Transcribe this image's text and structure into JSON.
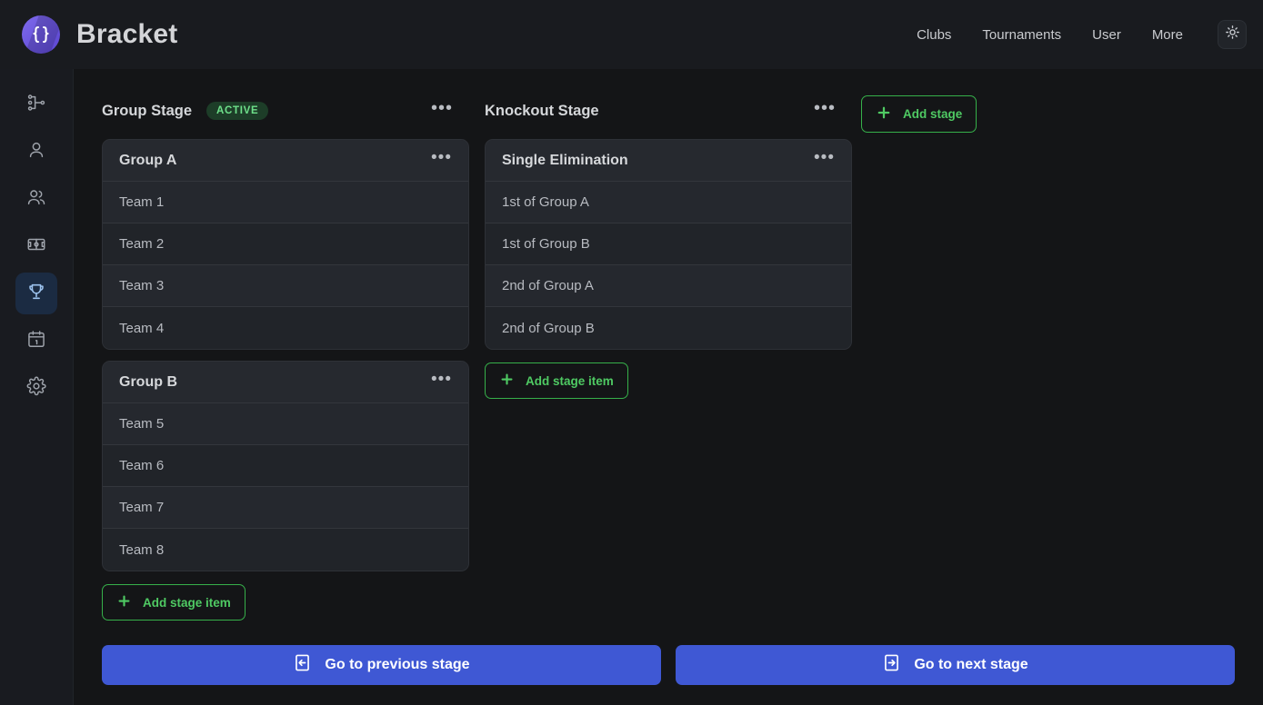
{
  "header": {
    "brand_name": "Bracket",
    "logo_icon": "curly-braces-logo",
    "nav": [
      {
        "label": "Clubs"
      },
      {
        "label": "Tournaments"
      },
      {
        "label": "User"
      },
      {
        "label": "More"
      }
    ],
    "theme_toggle_icon": "sun-icon"
  },
  "sidebar": {
    "items": [
      {
        "icon": "bracket-icon",
        "name": "sidebar-item-brackets",
        "active": false
      },
      {
        "icon": "user-icon",
        "name": "sidebar-item-user",
        "active": false
      },
      {
        "icon": "users-icon",
        "name": "sidebar-item-teams",
        "active": false
      },
      {
        "icon": "field-icon",
        "name": "sidebar-item-courts",
        "active": false
      },
      {
        "icon": "trophy-icon",
        "name": "sidebar-item-tournaments",
        "active": true
      },
      {
        "icon": "calendar-icon",
        "name": "sidebar-item-schedule",
        "active": false
      },
      {
        "icon": "gear-icon",
        "name": "sidebar-item-settings",
        "active": false
      }
    ]
  },
  "stages": {
    "group_stage": {
      "title": "Group Stage",
      "badge": "ACTIVE",
      "menu_icon": "ellipsis-icon",
      "cards": [
        {
          "title": "Group A",
          "menu_icon": "ellipsis-icon",
          "rows": [
            "Team 1",
            "Team 2",
            "Team 3",
            "Team 4"
          ]
        },
        {
          "title": "Group B",
          "menu_icon": "ellipsis-icon",
          "rows": [
            "Team 5",
            "Team 6",
            "Team 7",
            "Team 8"
          ]
        }
      ],
      "add_item_label": "Add stage item"
    },
    "knockout_stage": {
      "title": "Knockout Stage",
      "menu_icon": "ellipsis-icon",
      "cards": [
        {
          "title": "Single Elimination",
          "menu_icon": "ellipsis-icon",
          "rows": [
            "1st of Group A",
            "1st of Group B",
            "2nd of Group A",
            "2nd of Group B"
          ]
        }
      ],
      "add_item_label": "Add stage item"
    },
    "add_stage_label": "Add stage"
  },
  "bottom_nav": {
    "previous_label": "Go to previous stage",
    "previous_icon": "arrow-left-box-icon",
    "next_label": "Go to next stage",
    "next_icon": "arrow-right-box-icon"
  },
  "colors": {
    "page_bg": "#141517",
    "header_bg": "#191b1f",
    "sidebar_bg": "#191b20",
    "card_bg": "#24272d",
    "accent_green": "#4fca63",
    "accent_blue": "#3f58d4",
    "active_nav_bg": "#1b2b42",
    "badge_bg": "#1d3d28"
  }
}
